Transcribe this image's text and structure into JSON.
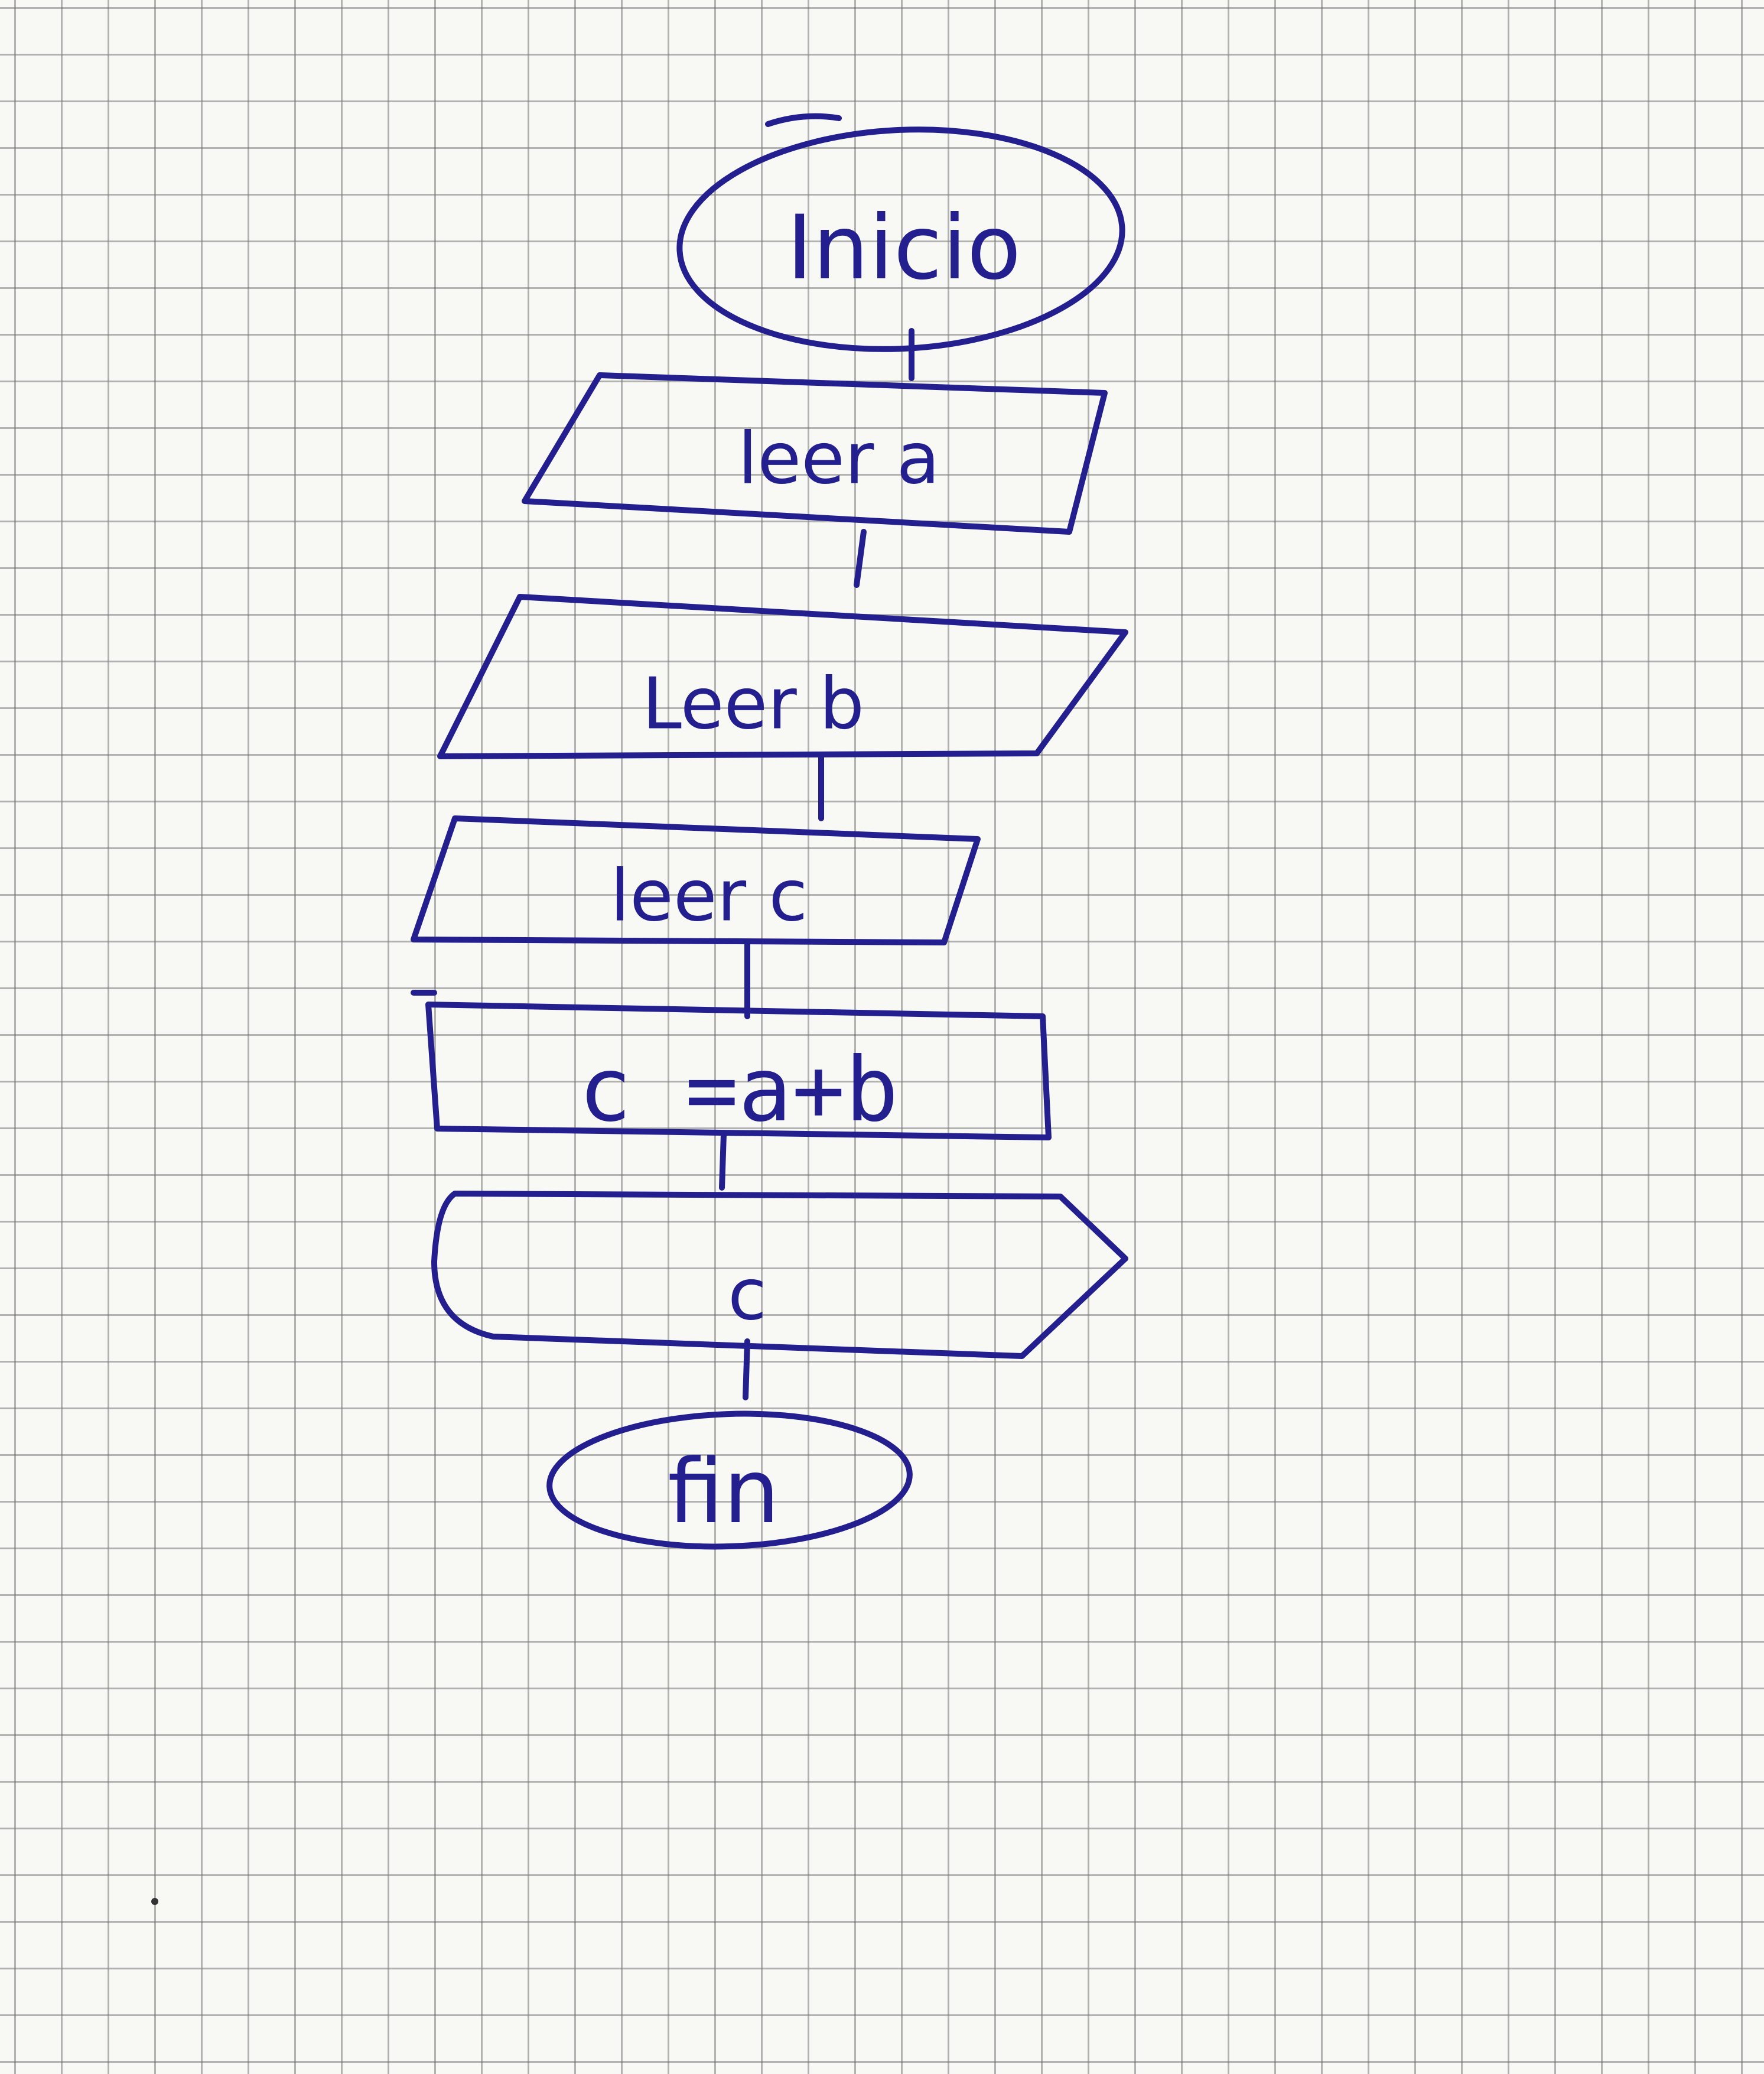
{
  "flowchart": {
    "start": "Inicio",
    "input_a": "leer a",
    "input_b": "Leer b",
    "input_c": "leer c",
    "process": "c =a+b",
    "output": "c",
    "end": "fin"
  },
  "colors": {
    "ink": "#241f8f",
    "paper": "#f8f8f5",
    "grid": "#8a8a8a"
  }
}
